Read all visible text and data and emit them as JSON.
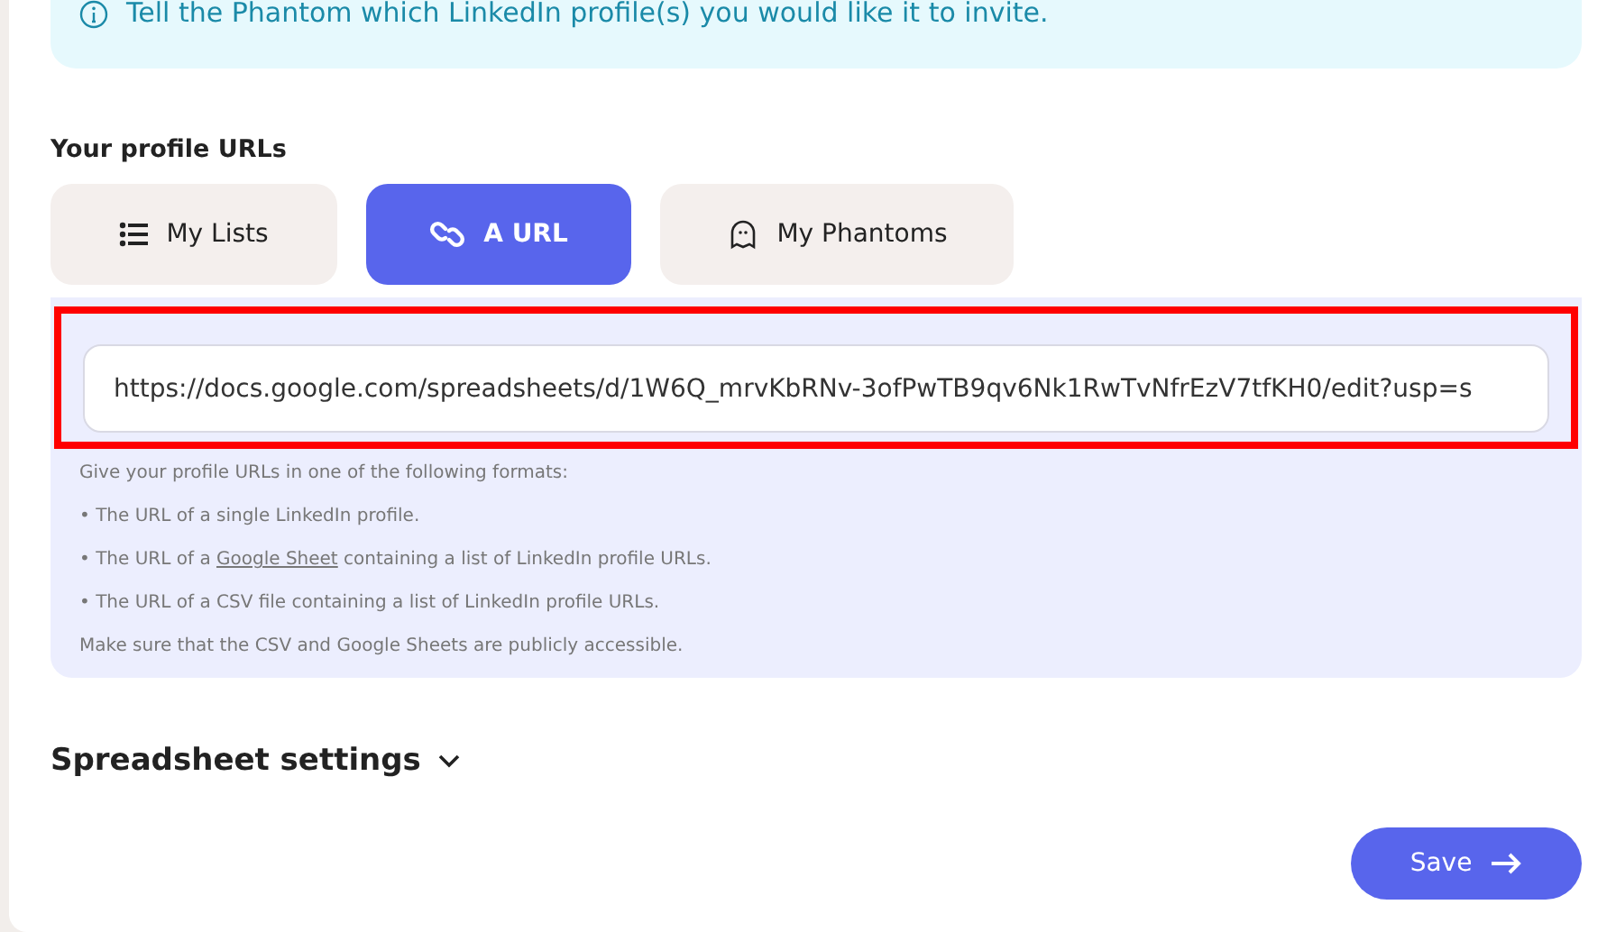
{
  "info_banner": {
    "text": "Tell the Phantom which LinkedIn profile(s) you would like it to invite."
  },
  "profile_urls": {
    "label": "Your profile URLs",
    "tabs": [
      {
        "label": "My Lists",
        "kind": "list",
        "selected": false
      },
      {
        "label": "A URL",
        "kind": "link",
        "selected": true
      },
      {
        "label": "My Phantoms",
        "kind": "ghost",
        "selected": false
      }
    ],
    "url_field": {
      "value": "https://docs.google.com/spreadsheets/d/1W6Q_mrvKbRNv-3ofPwTB9qv6Nk1RwTvNfrEzV7tfKH0/edit?usp=s",
      "highlighted": true
    },
    "help": [
      {
        "text": "Give your profile URLs in one of the following formats:"
      },
      {
        "text": "• The URL of a single LinkedIn profile."
      },
      {
        "text": "• The URL of a ",
        "link": "Google Sheet",
        "after": " containing a list of LinkedIn profile URLs."
      },
      {
        "text": "• The URL of a CSV file containing a list of LinkedIn profile URLs."
      },
      {
        "text": "Make sure that the CSV and Google Sheets are publicly accessible."
      }
    ]
  },
  "spreadsheet_settings": {
    "title": "Spreadsheet settings",
    "expanded": false
  },
  "save_button": {
    "label": "Save"
  }
}
